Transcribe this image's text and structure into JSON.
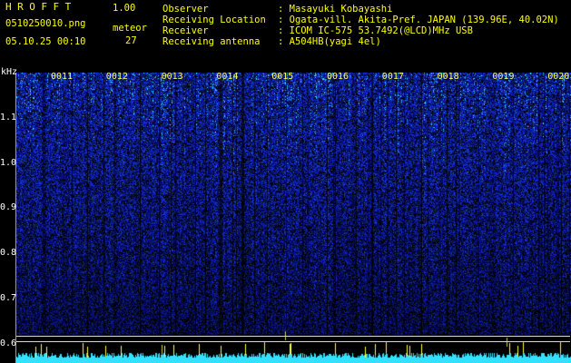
{
  "header": {
    "logo": "HROFFT",
    "version": "1.00",
    "filename": "0510250010.png",
    "datetime": "05.10.25 00:10",
    "meteor_label": "meteor",
    "meteor_count": "27"
  },
  "info": {
    "observer_label": "Observer",
    "observer_value": ": Masayuki Kobayashi",
    "location_label": "Receiving Location",
    "location_value": ": Ogata-vill. Akita-Pref. JAPAN (139.96E, 40.02N)",
    "receiver_label": "Receiver",
    "receiver_value": ": ICOM IC-575 53.7492(@LCD)MHz USB",
    "antenna_label": "Receiving antenna",
    "antenna_value": ": A504HB(yagi 4el)"
  },
  "colors": {
    "label_yellow": "#ffff00",
    "value_green": "#33ff33",
    "signal_blue": "#1a2fd0",
    "noise_cyan": "#33e0ff"
  },
  "chart_data": {
    "type": "heatmap",
    "ylabel": "kHz",
    "y_ticks": [
      "1.1",
      "1.0",
      "0.9",
      "0.8",
      "0.7",
      "0.6"
    ],
    "ylim": [
      0.58,
      1.2
    ],
    "time_labels": [
      "0011",
      "0012",
      "0013",
      "0014",
      "0015",
      "0016",
      "0017",
      "0018",
      "0019",
      "0020"
    ]
  }
}
